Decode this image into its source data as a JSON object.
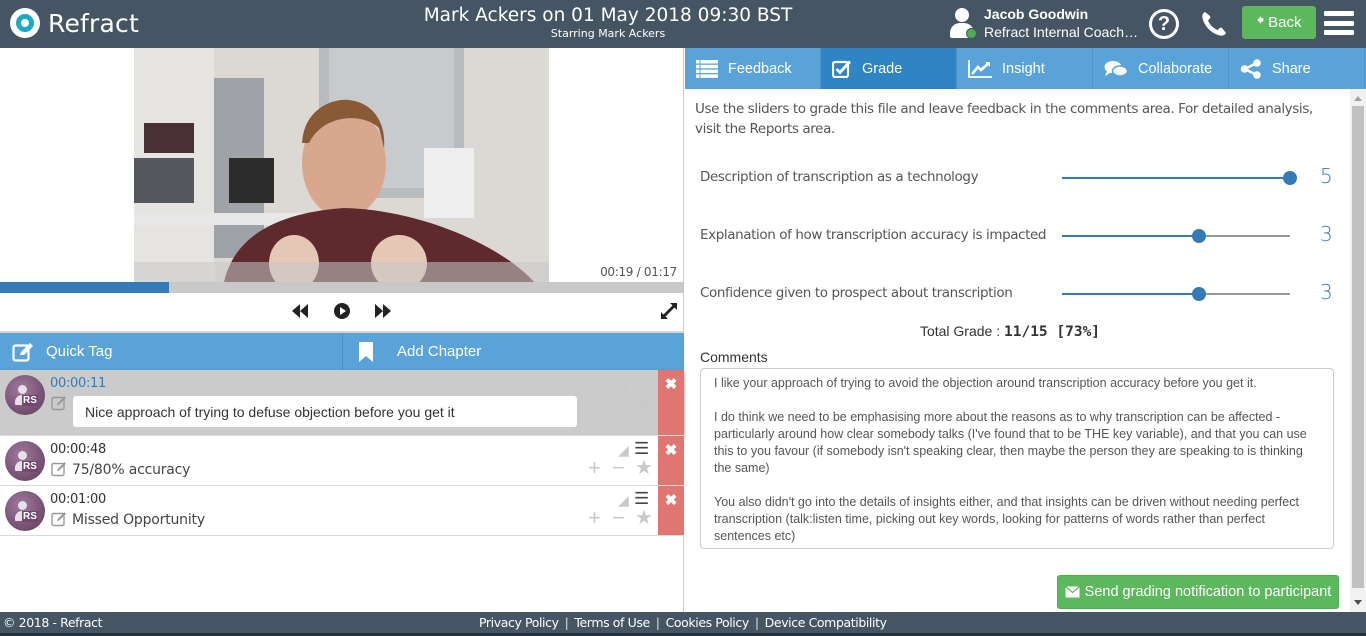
{
  "app": {
    "name": "Refract",
    "brand_color": "#1aa9c9",
    "header_color": "#455564"
  },
  "header": {
    "title": "Mark Ackers on 01 May 2018 09:30 BST",
    "subtitle": "Starring Mark Ackers",
    "user": {
      "name": "Jacob Goodwin",
      "org": "Refract Internal Coaching",
      "status": "online",
      "status_color": "#4cae4c"
    },
    "icons": [
      "help-icon",
      "phone-icon",
      "menu-icon"
    ],
    "back_label": "Back"
  },
  "player": {
    "current_time": "00:19",
    "duration": "01:17",
    "time_readout": "00:19 / 01:17",
    "progress_percent": 24.7,
    "controls": [
      "rewind-icon",
      "play-icon",
      "fast-forward-icon",
      "fullscreen-icon"
    ]
  },
  "left_toolbar": {
    "quick_tag_label": "Quick Tag",
    "add_chapter_label": "Add Chapter"
  },
  "tags": [
    {
      "initials": "RS",
      "time": "00:00:11",
      "text": "Nice approach of trying to defuse objection before you get it",
      "editing": true
    },
    {
      "initials": "RS",
      "time": "00:00:48",
      "text": "75/80% accuracy",
      "editing": false
    },
    {
      "initials": "RS",
      "time": "00:01:00",
      "text": "Missed Opportunity",
      "editing": false
    }
  ],
  "tabs": [
    {
      "label": "Feedback",
      "icon": "list-icon",
      "active": false
    },
    {
      "label": "Grade",
      "icon": "checkbox-icon",
      "active": true
    },
    {
      "label": "Insight",
      "icon": "line-chart-icon",
      "active": false
    },
    {
      "label": "Collaborate",
      "icon": "comments-icon",
      "active": false
    },
    {
      "label": "Share",
      "icon": "share-icon",
      "active": false
    }
  ],
  "grade": {
    "intro": "Use the sliders to grade this file and leave feedback in the comments area. For detailed analysis, visit the Reports area.",
    "max_per_criterion": 5,
    "criteria": [
      {
        "label": "Description of transcription as a technology",
        "value": 5
      },
      {
        "label": "Explanation of how transcription accuracy is impacted",
        "value": 3
      },
      {
        "label": "Confidence given to prospect about transcription",
        "value": 3
      }
    ],
    "total_label": "Total Grade :",
    "total_value": "11/15 [73%]",
    "comments_label": "Comments",
    "comments": "I like your approach of trying to avoid the objection around transcription accuracy before you get it.\n\nI do think we need to be emphasising more about the reasons as to why transcription can be affected - particularly around how clear somebody talks (I've found that to be THE key variable), and that you can use this to you favour (if somebody isn't speaking clear, then maybe the person they are speaking to is thinking the same)\n\nYou also didn't go into the details of insights either, and that insights can be driven without needing perfect transcription (talk:listen time, picking out key words, looking for patterns of words rather than perfect sentences etc)",
    "send_label": "Send grading notification to participant"
  },
  "footer": {
    "copyright": "© 2018 - Refract",
    "links": [
      "Privacy Policy",
      "Terms of Use",
      "Cookies Policy",
      "Device Compatibility"
    ]
  }
}
